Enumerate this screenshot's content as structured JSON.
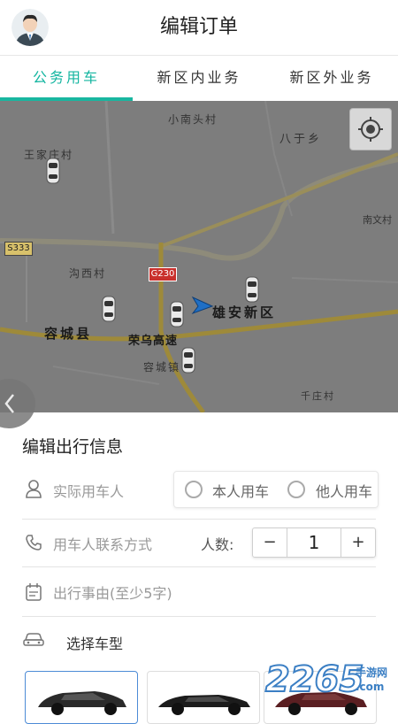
{
  "header": {
    "title": "编辑订单"
  },
  "tabs": [
    {
      "label": "公务用车",
      "active": true
    },
    {
      "label": "新区内业务",
      "active": false
    },
    {
      "label": "新区外业务",
      "active": false
    }
  ],
  "map": {
    "labels": {
      "xiaonan": "小南头村",
      "bayu": "八于乡",
      "wangjia": "王家庄村",
      "nanwen": "南文村",
      "s333": "S333",
      "gouxi": "沟西村",
      "g230": "G230",
      "xiongan": "雄安新区",
      "rongcheng": "容城县",
      "rongwu": "荣乌高速",
      "rongchengzhen": "容城镇",
      "qianzhuang": "千庄村"
    }
  },
  "form": {
    "section_title": "编辑出行信息",
    "passenger_placeholder": "实际用车人",
    "radio_self": "本人用车",
    "radio_other": "他人用车",
    "contact_placeholder": "用车人联系方式",
    "count_label": "人数:",
    "count_value": "1",
    "minus": "−",
    "plus": "+",
    "reason_placeholder": "出行事由(至少5字)",
    "car_type_label": "选择车型"
  },
  "watermark": {
    "brand": "2265",
    "sub_text": "手游网",
    "url_text": ".com"
  },
  "colors": {
    "accent": "#19b6a0",
    "selected_border": "#4c8bd6"
  }
}
